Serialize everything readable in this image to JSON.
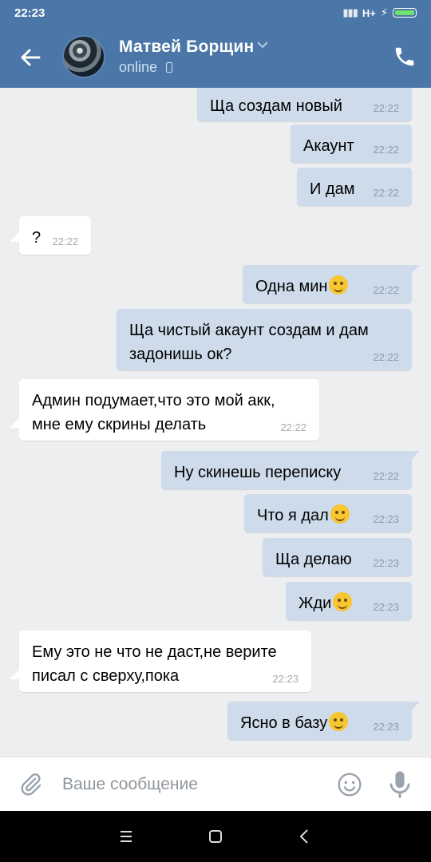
{
  "status_bar": {
    "time": "22:23",
    "network": "H+"
  },
  "header": {
    "contact_name": "Матвей Борщин",
    "contact_status": "online",
    "icons": [
      "back-arrow-icon",
      "chevron-down-icon",
      "mobile-phone-icon",
      "phone-call-icon"
    ]
  },
  "messages": [
    {
      "dir": "out",
      "text": "Ща создам новый",
      "time": "22:22"
    },
    {
      "dir": "out",
      "text": "Акаунт",
      "time": "22:22"
    },
    {
      "dir": "out",
      "text": "И дам",
      "time": "22:22"
    },
    {
      "dir": "in",
      "text": "?",
      "time": "22:22"
    },
    {
      "dir": "out",
      "text": "Одна мин",
      "emoji": "wink",
      "time": "22:22"
    },
    {
      "dir": "out",
      "text": "Ща чистый акаунт создам и дам",
      "text2": "задонишь ок?",
      "time": "22:22"
    },
    {
      "dir": "in",
      "text": "Админ подумает,что это мой акк,",
      "text2": "мне ему скрины делать",
      "time": "22:22"
    },
    {
      "dir": "out",
      "text": "Ну скинешь переписку",
      "time": "22:22"
    },
    {
      "dir": "out",
      "text": "Что я дал",
      "emoji": "wink",
      "time": "22:23"
    },
    {
      "dir": "out",
      "text": "Ща делаю",
      "time": "22:23"
    },
    {
      "dir": "out",
      "text": "Жди",
      "emoji": "smile",
      "time": "22:23"
    },
    {
      "dir": "in",
      "text": "Ему это не что не даст,не верите",
      "text2": "писал с сверху,пока",
      "time": "22:23"
    },
    {
      "dir": "out",
      "text": "Ясно в базу",
      "emoji": "laugh",
      "time": "22:23"
    }
  ],
  "composer": {
    "placeholder": "Ваше сообщение",
    "icons": [
      "paperclip-icon",
      "emoji-icon",
      "microphone-icon"
    ]
  },
  "nav_bar": {
    "icons": [
      "menu-icon",
      "home-icon",
      "back-icon"
    ]
  },
  "colors": {
    "header": "#4a76a8",
    "outgoing_bubble": "#cddbeb",
    "incoming_bubble": "#ffffff",
    "chat_background": "#edeef0"
  }
}
